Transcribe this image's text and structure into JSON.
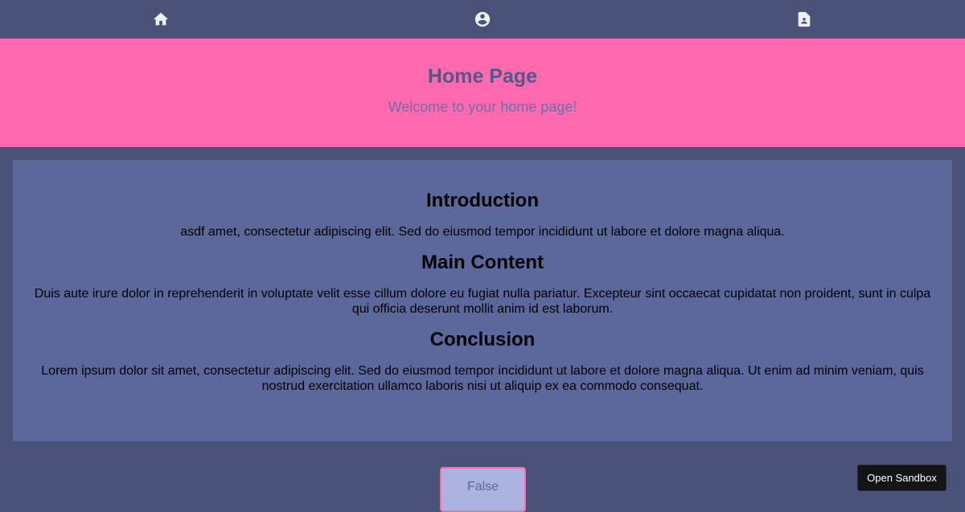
{
  "nav": {
    "items": [
      {
        "icon": "home-icon"
      },
      {
        "icon": "account-circle-icon"
      },
      {
        "icon": "contact-page-icon"
      }
    ]
  },
  "hero": {
    "title": "Home Page",
    "subtitle": "Welcome to your home page!",
    "background": "#ff69ae"
  },
  "content": {
    "sections": [
      {
        "heading": "Introduction",
        "text": "asdf amet, consectetur adipiscing elit. Sed do eiusmod tempor incididunt ut labore et dolore magna aliqua."
      },
      {
        "heading": "Main Content",
        "text": "Duis aute irure dolor in reprehenderit in voluptate velit esse cillum dolore eu fugiat nulla pariatur. Excepteur sint occaecat cupidatat non proident, sunt in culpa qui officia deserunt mollit anim id est laborum."
      },
      {
        "heading": "Conclusion",
        "text": "Lorem ipsum dolor sit amet, consectetur adipiscing elit. Sed do eiusmod tempor incididunt ut labore et dolore magna aliqua. Ut enim ad minim veniam, quis nostrud exercitation ullamco laboris nisi ut aliquip ex ea commodo consequat."
      }
    ]
  },
  "toggle": {
    "label": "False"
  },
  "sandbox": {
    "label": "Open Sandbox"
  },
  "colors": {
    "page_bg": "#4a5277",
    "panel_bg": "#5c689b",
    "accent": "#ff69ae"
  }
}
